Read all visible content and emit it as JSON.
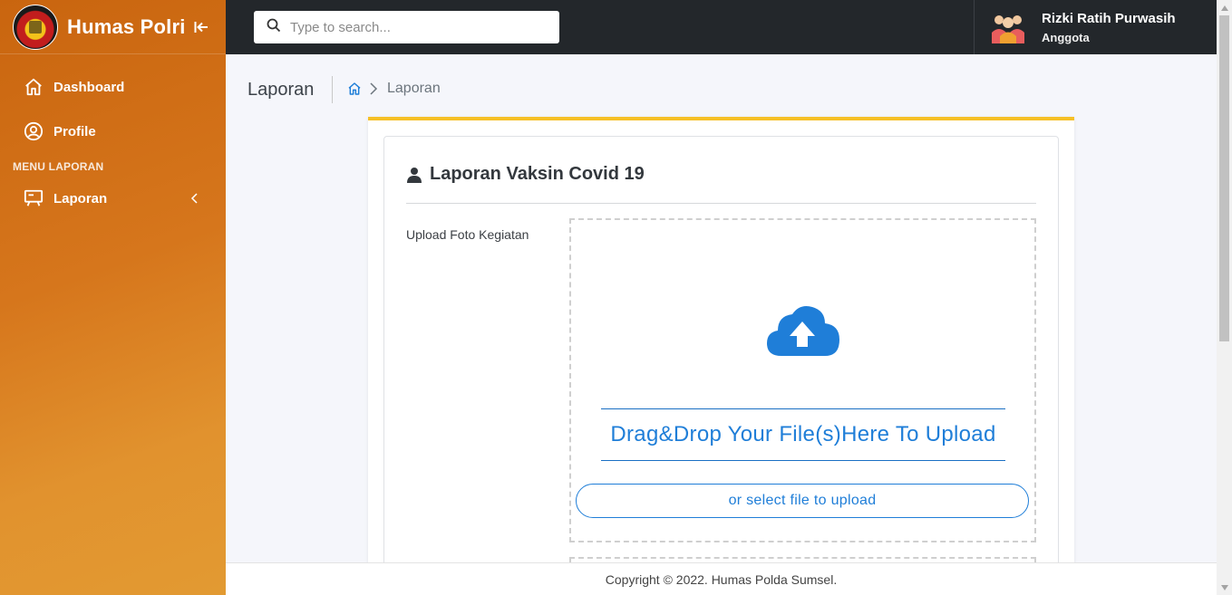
{
  "brand": {
    "title": "Humas Polri"
  },
  "sidebar": {
    "items": [
      {
        "label": "Dashboard",
        "icon": "home-icon"
      },
      {
        "label": "Profile",
        "icon": "user-circle-icon"
      }
    ],
    "section_label": "MENU LAPORAN",
    "laporan": {
      "label": "Laporan",
      "icon": "presentation-board-icon"
    }
  },
  "search": {
    "placeholder": "Type to search..."
  },
  "user": {
    "name": "Rizki Ratih Purwasih",
    "role": "Anggota"
  },
  "page": {
    "title": "Laporan",
    "breadcrumb_current": "Laporan"
  },
  "card": {
    "title": "Laporan Vaksin Covid 19",
    "field_label": "Upload Foto Kegiatan",
    "dropzone_text": "Drag&Drop Your File(s)Here To Upload",
    "select_button": "or select file to upload"
  },
  "footer": {
    "text": "Copyright © 2022. Humas Polda Sumsel."
  },
  "colors": {
    "accent": "#1f7ed8",
    "card_top": "#f6c026",
    "sidebar": "#d6761c",
    "topbar": "#23272b"
  }
}
